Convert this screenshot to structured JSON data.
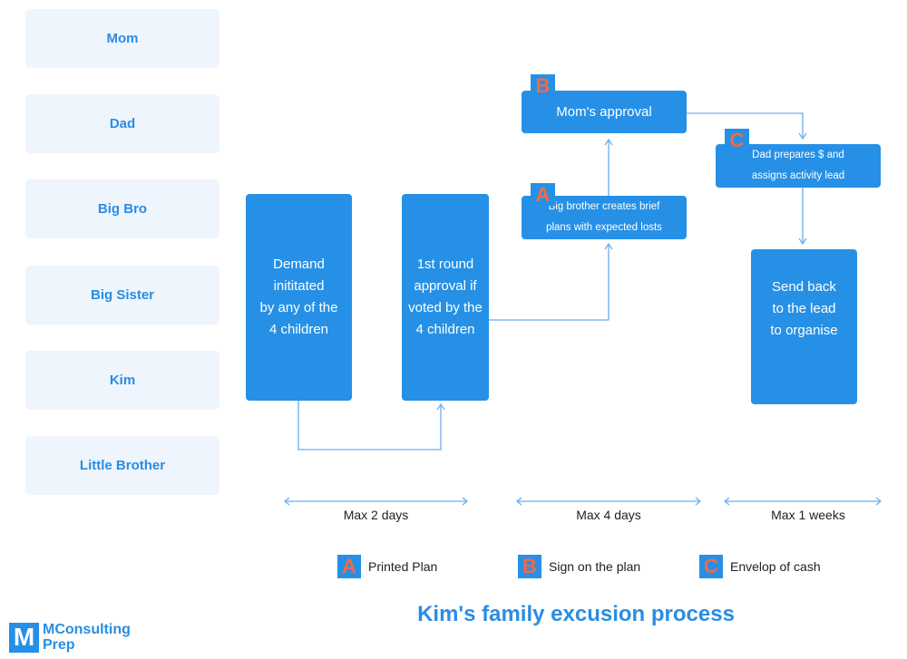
{
  "lanes": [
    "Mom",
    "Dad",
    "Big Bro",
    "Big Sister",
    "Kim",
    "Little Brother"
  ],
  "steps": {
    "demand": [
      "Demand",
      "inititated",
      "by any of the",
      "4 children"
    ],
    "first_round": [
      "1st round",
      "approval if",
      "voted by the",
      "4 children"
    ],
    "big_brother": [
      "Big brother creates brief",
      "plans with expected losts"
    ],
    "mom_approval": "Mom's approval",
    "dad_prepares": [
      "Dad prepares $ and",
      "assigns activity lead"
    ],
    "send_back": [
      "Send back",
      "to the lead",
      "to organise"
    ]
  },
  "badges": {
    "a": "A",
    "b": "B",
    "c": "C"
  },
  "durations": [
    "Max 2 days",
    "Max 4 days",
    "Max 1 weeks"
  ],
  "legend": [
    {
      "letter": "A",
      "label": "Printed Plan"
    },
    {
      "letter": "B",
      "label": "Sign on the plan"
    },
    {
      "letter": "C",
      "label": "Envelop of cash"
    }
  ],
  "title": "Kim's family excusion process",
  "logo": {
    "mark": "M",
    "line1": "MConsulting",
    "line2": "Prep"
  },
  "colors": {
    "box": "#2690e6",
    "badge_letter": "#f26a45",
    "lane_bg": "#eef5fc",
    "accent": "#2a8de2"
  }
}
